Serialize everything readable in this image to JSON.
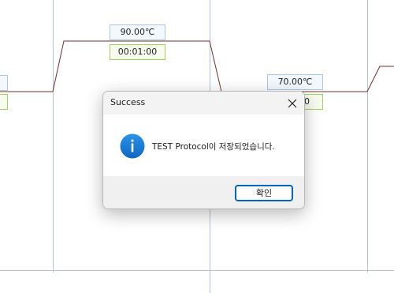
{
  "profile": {
    "line_color": "#7a2b2b",
    "grid_color": "#aec4da",
    "steps": [
      {
        "temperature": "",
        "time": ""
      },
      {
        "temperature": "90.00℃",
        "time": "00:01:00"
      },
      {
        "temperature": "70.00℃",
        "time": "00"
      },
      {
        "temperature": "",
        "time": ""
      }
    ]
  },
  "dialog": {
    "title": "Success",
    "close_icon": "close-icon",
    "icon": "info-icon",
    "icon_color": "#1a7fd6",
    "message": "TEST Protocol이 저장되었습니다.",
    "ok_label": "확인",
    "accent_color": "#0067c0"
  }
}
